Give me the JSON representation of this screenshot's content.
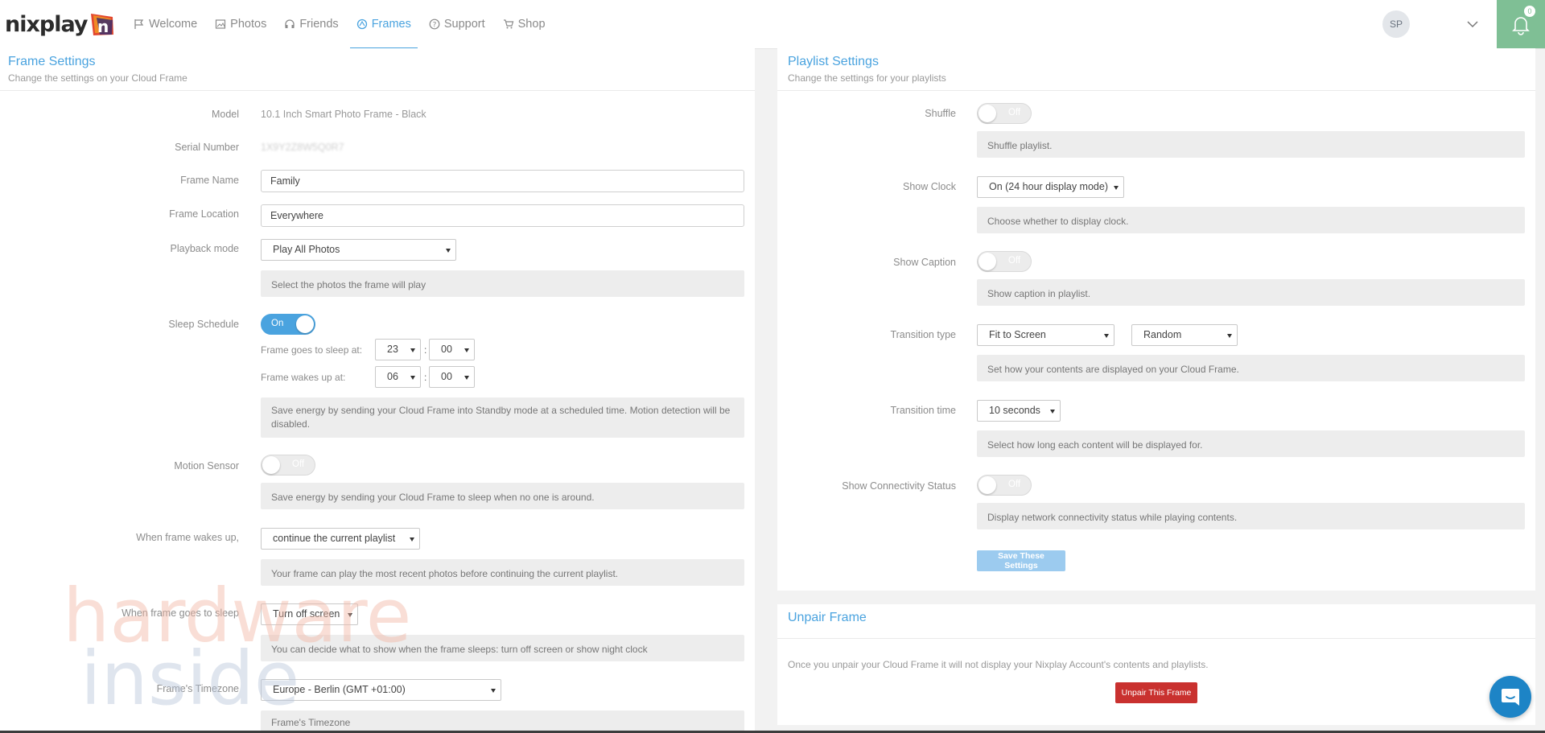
{
  "nav": {
    "brand": "nixplay",
    "items": [
      {
        "label": "Welcome",
        "icon": "flag-icon"
      },
      {
        "label": "Photos",
        "icon": "photo-icon"
      },
      {
        "label": "Friends",
        "icon": "headphones-icon"
      },
      {
        "label": "Frames",
        "icon": "frame-icon",
        "active": true
      },
      {
        "label": "Support",
        "icon": "question-icon"
      },
      {
        "label": "Shop",
        "icon": "cart-icon"
      }
    ],
    "avatar_initials": "SP",
    "notification_count": "0"
  },
  "frame_settings": {
    "title": "Frame Settings",
    "subtitle": "Change the settings on your Cloud Frame",
    "model_label": "Model",
    "model_value": "10.1 Inch Smart Photo Frame - Black",
    "serial_label": "Serial Number",
    "serial_value": "1X9Y2Z8W5Q0R7",
    "frame_name_label": "Frame Name",
    "frame_name_value": "Family",
    "frame_location_label": "Frame Location",
    "frame_location_value": "Everywhere",
    "playback_label": "Playback mode",
    "playback_value": "Play All Photos",
    "playback_help": "Select the photos the frame will play",
    "sleep_label": "Sleep Schedule",
    "sleep_state": "On",
    "sleep_at_label": "Frame goes to sleep at:",
    "sleep_hour": "23",
    "sleep_min": "00",
    "wake_at_label": "Frame wakes up at:",
    "wake_hour": "06",
    "wake_min": "00",
    "colon": ":",
    "sleep_help": "Save energy by sending your Cloud Frame into Standby mode at a scheduled time. Motion detection will be disabled.",
    "motion_label": "Motion Sensor",
    "motion_state": "Off",
    "motion_help": "Save energy by sending your Cloud Frame to sleep when no one is around.",
    "wakes_label": "When frame wakes up,",
    "wakes_value": "continue the current playlist",
    "wakes_help": "Your frame can play the most recent photos before continuing the current playlist.",
    "sleeps_label": "When frame goes to sleep",
    "sleeps_value": "Turn off screen",
    "sleeps_help": "You can decide what to show when the frame sleeps: turn off screen or show night clock",
    "timezone_label": "Frame's Timezone",
    "timezone_value": "Europe - Berlin (GMT +01:00)",
    "timezone_help": "Frame's Timezone"
  },
  "playlist_settings": {
    "title": "Playlist Settings",
    "subtitle": "Change the settings for your playlists",
    "shuffle_label": "Shuffle",
    "shuffle_state": "Off",
    "shuffle_help": "Shuffle playlist.",
    "clock_label": "Show Clock",
    "clock_value": "On (24 hour display mode)",
    "clock_help": "Choose whether to display clock.",
    "caption_label": "Show Caption",
    "caption_state": "Off",
    "caption_help": "Show caption in playlist.",
    "transition_type_label": "Transition type",
    "transition_type_value": "Fit to Screen",
    "transition_effect_value": "Random",
    "transition_type_help": "Set how your contents are displayed on your Cloud Frame.",
    "transition_time_label": "Transition time",
    "transition_time_value": "10 seconds",
    "transition_time_help": "Select how long each content will be displayed for.",
    "connectivity_label": "Show Connectivity Status",
    "connectivity_state": "Off",
    "connectivity_help": "Display network connectivity status while playing contents.",
    "save_label": "Save These Settings"
  },
  "unpair": {
    "title": "Unpair Frame",
    "text": "Once you unpair your Cloud Frame it will not display your Nixplay Account's contents and playlists.",
    "button_label": "Unpair This Frame"
  },
  "watermark": {
    "line1": "hardware",
    "line2": "inside"
  },
  "colors": {
    "accent": "#4aa3df",
    "notif_bg": "#7fbf95",
    "danger": "#c9312f",
    "save_disabled": "#9ccbef",
    "chat": "#1d84c6"
  }
}
